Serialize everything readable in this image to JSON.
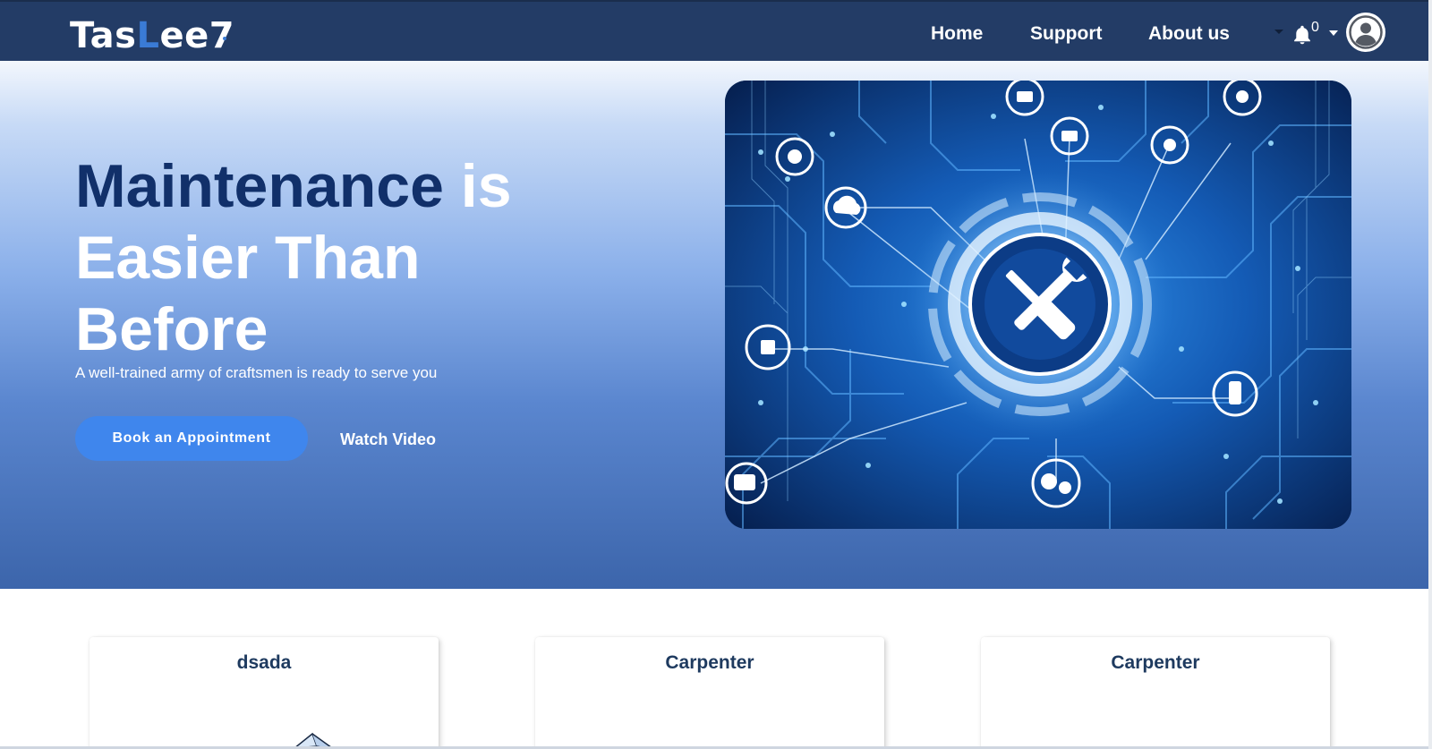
{
  "brand": {
    "logo_part1": "Tas",
    "logo_accent": "L",
    "logo_part2": "ee7",
    "primary_color": "#233c66",
    "accent_color": "#3f86ed"
  },
  "nav": {
    "links": [
      {
        "label": "Home"
      },
      {
        "label": "Support"
      },
      {
        "label": "About us"
      }
    ],
    "notifications_count": "0",
    "icons": {
      "notifications": "bell-icon",
      "account": "user-avatar-icon",
      "dropdown": "caret-down-icon"
    }
  },
  "hero": {
    "title_dark": "Maintenance",
    "title_light_1": "is",
    "title_light_2": "Easier Than",
    "title_light_3": "Before",
    "subtitle": "A well-trained army of craftsmen is ready to serve you",
    "primary_cta": "Book an Appointment",
    "secondary_cta": "Watch Video",
    "image_subject": "circuit-board-with-wrench-and-screwdriver"
  },
  "cards": [
    {
      "title": "dsada"
    },
    {
      "title": "Carpenter"
    },
    {
      "title": "Carpenter"
    }
  ]
}
